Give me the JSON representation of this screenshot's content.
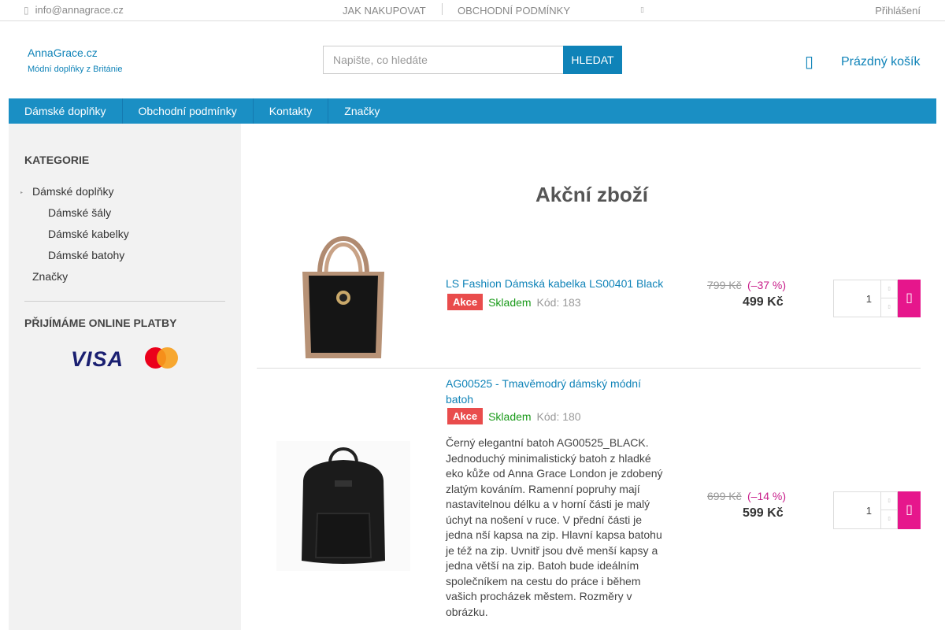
{
  "topbar": {
    "email": "info@annagrace.cz",
    "links": [
      "JAK NAKUPOVAT",
      "OBCHODNÍ PODMÍNKY"
    ],
    "login": "Přihlášení"
  },
  "header": {
    "brand_name": "AnnaGrace.cz",
    "brand_tagline": "Módní doplňky z Británie",
    "search_placeholder": "Napište, co hledáte",
    "search_button": "HLEDAT",
    "cart_label": "Prázdný košík"
  },
  "nav": [
    "Dámské doplňky",
    "Obchodní podmínky",
    "Kontakty",
    "Značky"
  ],
  "sidebar": {
    "categories_title": "KATEGORIE",
    "categories": [
      {
        "label": "Dámské doplňky"
      },
      {
        "label": "Dámské šály"
      },
      {
        "label": "Dámské kabelky"
      },
      {
        "label": "Dámské batohy"
      },
      {
        "label": "Značky"
      }
    ],
    "payments_title": "PŘIJÍMÁME ONLINE PLATBY",
    "visa": "VISA"
  },
  "page_title": "Akční zboží",
  "products": [
    {
      "name": "LS Fashion Dámská kabelka LS00401 Black",
      "badge": "Akce",
      "stock": "Skladem",
      "code": "Kód: 183",
      "old_price": "799 Kč",
      "discount": "(–37 %)",
      "price": "499 Kč",
      "qty": "1"
    },
    {
      "name": "AG00525 - Tmavěmodrý dámský módní batoh",
      "badge": "Akce",
      "stock": "Skladem",
      "code": "Kód: 180",
      "description": "Černý elegantní batoh AG00525_BLACK. Jednoduchý minimalistický batoh z hladké eko kůže od Anna Grace London je zdobený zlatým kováním. Ramenní popruhy mají nastavitelnou délku a v horní části je malý úchyt na nošení v ruce. V přední části je jedna nší kapsa na zip. Hlavní kapsa batohu je též na zip. Uvnitř jsou dvě menší kapsy a jedna větší na zip. Batoh bude ideálním společníkem na cestu do práce i během vašich procházek městem. Rozměry v obrázku.",
      "old_price": "699 Kč",
      "discount": "(–14 %)",
      "price": "599 Kč",
      "qty": "1"
    }
  ]
}
